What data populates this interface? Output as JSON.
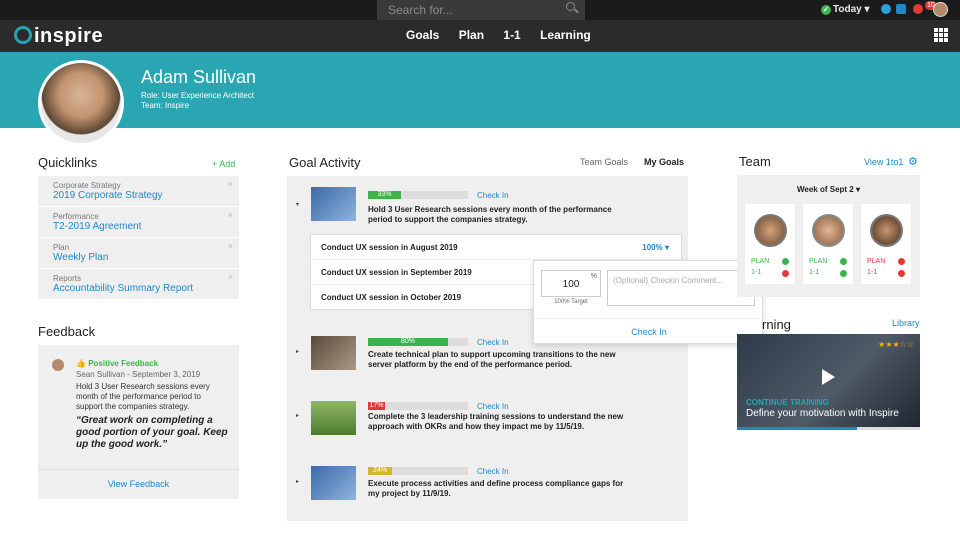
{
  "topbar": {
    "search_placeholder": "Search for...",
    "today": "Today",
    "badge": "10"
  },
  "nav": {
    "logo": "inspire",
    "items": [
      "Goals",
      "Plan",
      "1-1",
      "Learning"
    ]
  },
  "profile": {
    "name": "Adam Sullivan",
    "role": "Role: User Experience Architect",
    "team": "Team: Inspire"
  },
  "quicklinks": {
    "title": "Quicklinks",
    "add": "+ Add",
    "items": [
      {
        "cat": "Corporate Strategy",
        "val": "2019 Corporate Strategy"
      },
      {
        "cat": "Performance",
        "val": "T2-2019 Agreement"
      },
      {
        "cat": "Plan",
        "val": "Weekly Plan"
      },
      {
        "cat": "Reports",
        "val": "Accountability Summary Report"
      }
    ]
  },
  "feedback": {
    "title": "Feedback",
    "kind": "Positive Feedback",
    "by": "Sean Sullivan - September 3, 2019",
    "body": "Hold 3 User Research sessions every month of the performance period to support the companies strategy.",
    "quote": "“Great work on completing a good portion of your goal. Keep up the good work.”",
    "view": "View Feedback"
  },
  "goals": {
    "title": "Goal Activity",
    "tab_team": "Team Goals",
    "tab_my": "My Goals",
    "checkin": "Check In",
    "items": [
      {
        "pct": "33%",
        "progress": 0.33,
        "color": "#3cb44b",
        "text": "Hold 3 User Research sessions every month of the performance period to support the companies strategy."
      },
      {
        "pct": "80%",
        "progress": 0.8,
        "color": "#3cb44b",
        "text": "Create technical plan to support upcoming transitions to the new server platform by the end of the performance period."
      },
      {
        "pct": "17%",
        "progress": 0.17,
        "color": "#e53935",
        "text": "Complete the 3 leadership training sessions to understand the new approach with OKRs and how they impact me by 11/5/19."
      },
      {
        "pct": "24%",
        "progress": 0.24,
        "color": "#d4b62a",
        "text": "Execute process activities and define process compliance gaps for my project by 11/9/19."
      }
    ],
    "subs": [
      "Conduct UX session in August 2019",
      "Conduct UX session in September 2019",
      "Conduct UX session in October 2019"
    ],
    "sub_pct": "100%"
  },
  "popup": {
    "value": "100",
    "unit": "%",
    "target": "100% Target",
    "placeholder": "(Optional) Checkin Comment...",
    "button": "Check In"
  },
  "team": {
    "title": "Team",
    "view": "View 1to1",
    "week": "Week of Sept 2",
    "cards": [
      {
        "l1": "PLAN",
        "l2": "1-1"
      },
      {
        "l1": "PLAN",
        "l2": "1-1"
      },
      {
        "l1": "PLAN",
        "l2": "1-1"
      }
    ]
  },
  "learning": {
    "title": "rning",
    "library": "Library",
    "cta": "CONTINUE TRAINING",
    "desc": "Define your motivation with Inspire",
    "stars": "★★★☆☆"
  }
}
